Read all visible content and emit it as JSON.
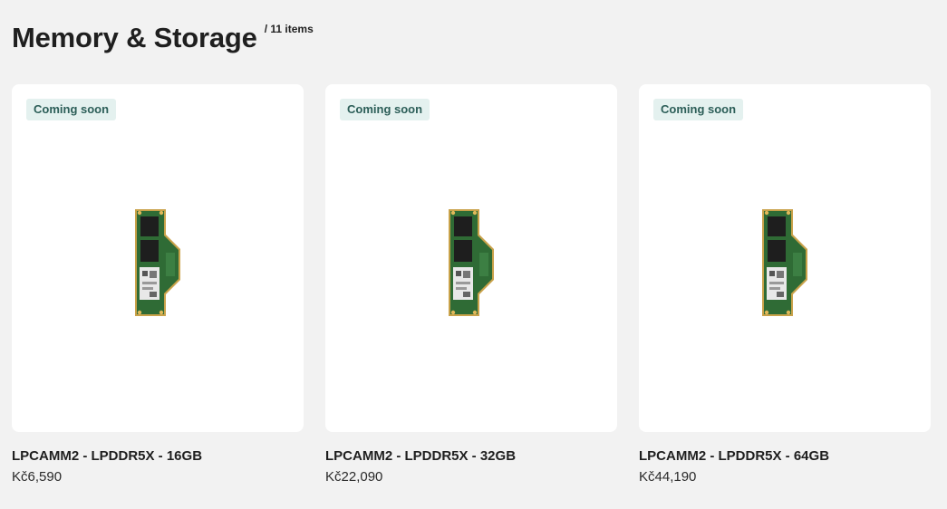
{
  "header": {
    "title": "Memory & Storage",
    "count": "/ 11 items"
  },
  "products": [
    {
      "badge": "Coming soon",
      "name": "LPCAMM2 - LPDDR5X - 16GB",
      "price": "Kč6,590"
    },
    {
      "badge": "Coming soon",
      "name": "LPCAMM2 - LPDDR5X - 32GB",
      "price": "Kč22,090"
    },
    {
      "badge": "Coming soon",
      "name": "LPCAMM2 - LPDDR5X - 64GB",
      "price": "Kč44,190"
    }
  ],
  "colors": {
    "background": "#f2f2f2",
    "card": "#ffffff",
    "badge_bg": "#e4f1ef",
    "badge_text": "#2c5e58",
    "pcb_green": "#2f6b35",
    "gold_edge": "#c9a24a"
  }
}
